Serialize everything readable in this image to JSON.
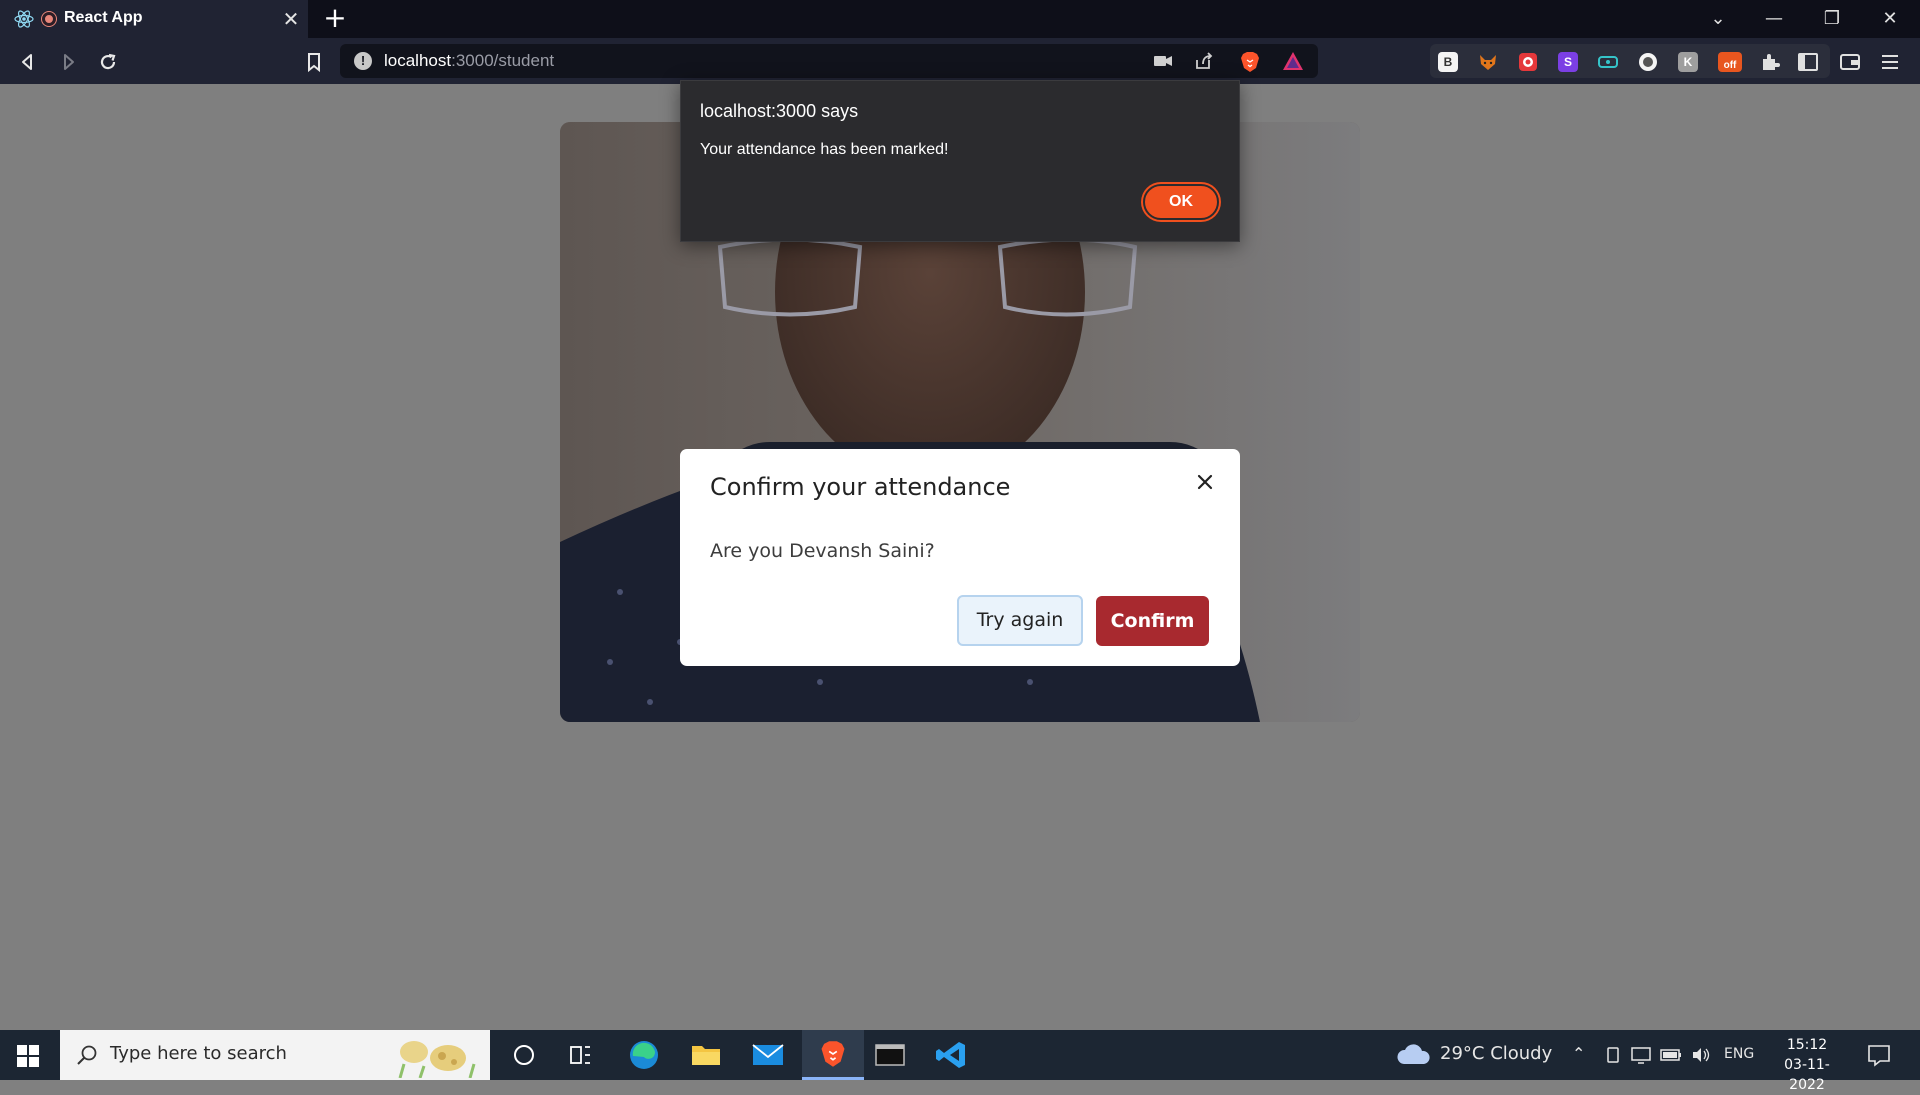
{
  "browser": {
    "tab_title": "React App",
    "tab_close": "✕",
    "new_tab": "+",
    "url_host": "localhost",
    "url_path": ":3000/student",
    "window_controls": {
      "dropdown": "⌄",
      "minimize": "—",
      "restore": "❐",
      "close": "✕"
    },
    "extensions": [
      {
        "name": "b-extension-icon",
        "label": "B"
      },
      {
        "name": "fox-extension-icon",
        "label": ""
      },
      {
        "name": "red-extension-icon",
        "label": ""
      },
      {
        "name": "s-extension-icon",
        "label": "S"
      },
      {
        "name": "teal-extension-icon",
        "label": ""
      },
      {
        "name": "circle-extension-icon",
        "label": ""
      },
      {
        "name": "k-extension-icon",
        "label": "K"
      },
      {
        "name": "off-extension-icon",
        "label": "off"
      }
    ]
  },
  "alert": {
    "title": "localhost:3000 says",
    "message": "Your attendance has been marked!",
    "ok_label": "OK"
  },
  "modal": {
    "title": "Confirm your attendance",
    "body": "Are you Devansh Saini?",
    "try_again_label": "Try again",
    "confirm_label": "Confirm"
  },
  "taskbar": {
    "search_placeholder": "Type here to search",
    "weather": "29°C  Cloudy",
    "language": "ENG",
    "time": "15:12",
    "date": "03-11-2022"
  },
  "colors": {
    "alert_ok": "#f0501e",
    "confirm_button": "#a8292f",
    "overlay": "#7f7f7f"
  }
}
